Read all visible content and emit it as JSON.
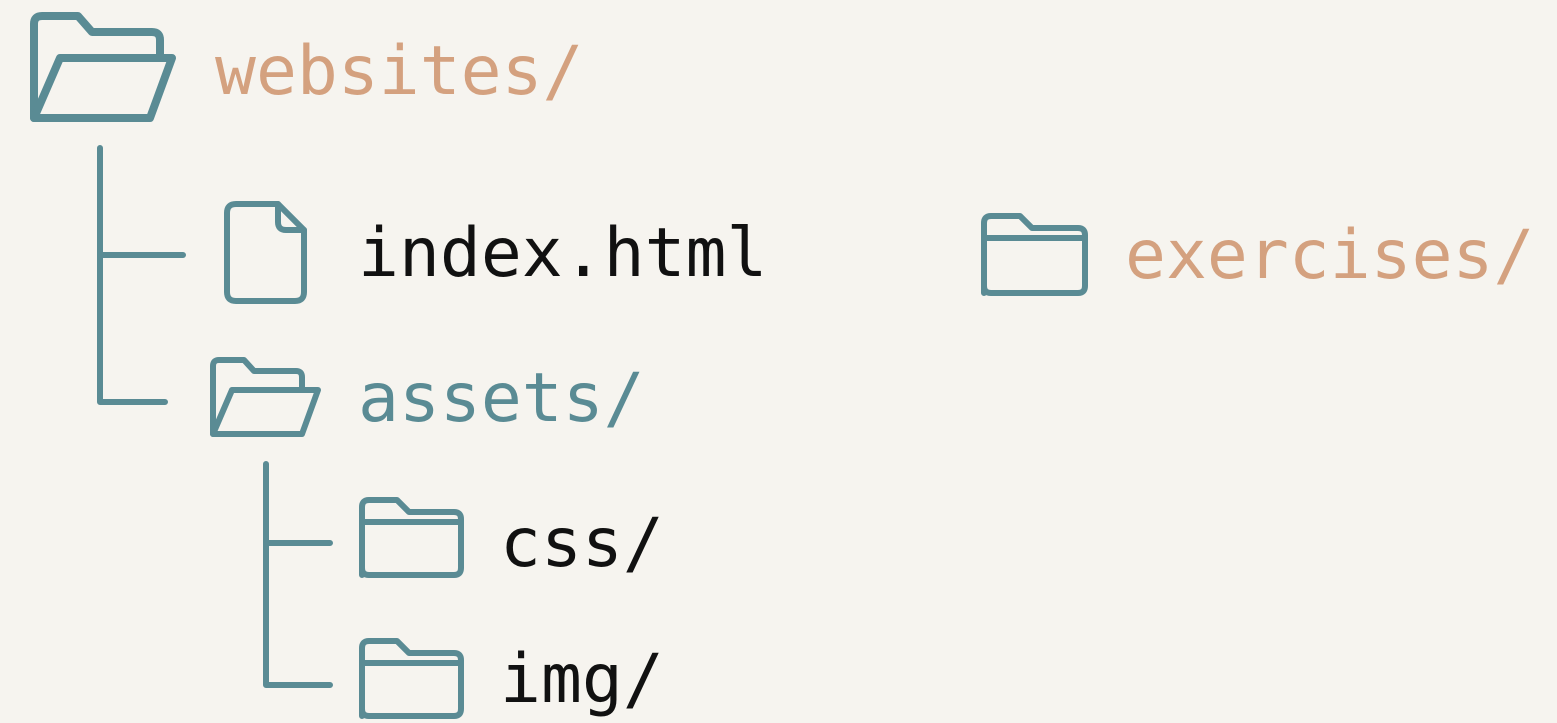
{
  "tree": {
    "root": {
      "label": "websites/",
      "icon": "folder-open-icon",
      "color": "#d4a17f"
    },
    "index_file": {
      "label": "index.html",
      "icon": "file-icon",
      "color": "#111111"
    },
    "assets": {
      "label": "assets/",
      "icon": "folder-open-icon",
      "color": "#5a8b94"
    },
    "css": {
      "label": "css/",
      "icon": "folder-icon",
      "color": "#111111"
    },
    "img": {
      "label": "img/",
      "icon": "folder-icon",
      "color": "#111111"
    }
  },
  "standalone": {
    "exercises": {
      "label": "exercises/",
      "icon": "folder-icon",
      "color": "#d4a17f"
    }
  },
  "colors": {
    "background": "#f6f4ef",
    "icon_stroke": "#5a8b94",
    "connector": "#5a8b94"
  }
}
